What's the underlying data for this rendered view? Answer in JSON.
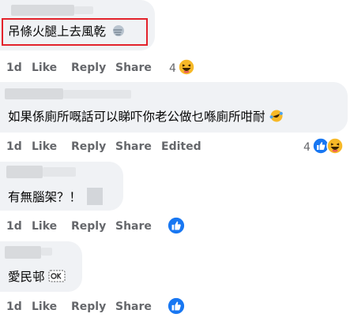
{
  "comments": [
    {
      "text": "吊條火腿上去風乾",
      "time": "1d",
      "like": "Like",
      "reply": "Reply",
      "share": "Share",
      "reactions": {
        "count": "4",
        "icons": [
          "haha-icon"
        ]
      }
    },
    {
      "text": "如果係廁所嘅話可以睇吓你老公做乜喺廁所咁耐",
      "time": "1d",
      "like": "Like",
      "reply": "Reply",
      "share": "Share",
      "edited": "Edited",
      "reactions": {
        "count": "4",
        "icons": [
          "like-icon",
          "haha-icon"
        ]
      }
    },
    {
      "text": "有無腦架？！",
      "time": "1d",
      "like": "Like",
      "reply": "Reply",
      "share": "Share",
      "reactions": {
        "count": "",
        "icons": [
          "like-icon"
        ]
      }
    },
    {
      "text": "愛民邨",
      "time": "1d",
      "like": "Like",
      "reply": "Reply",
      "share": "Share",
      "reactions": {
        "count": "",
        "icons": [
          "like-icon"
        ]
      }
    }
  ],
  "colors": {
    "bubble": "#f0f2f5",
    "meta_text": "#65676b",
    "highlight_box": "#e3222b",
    "like_blue": "#1877f2",
    "haha_yellow": "#f7b928"
  }
}
